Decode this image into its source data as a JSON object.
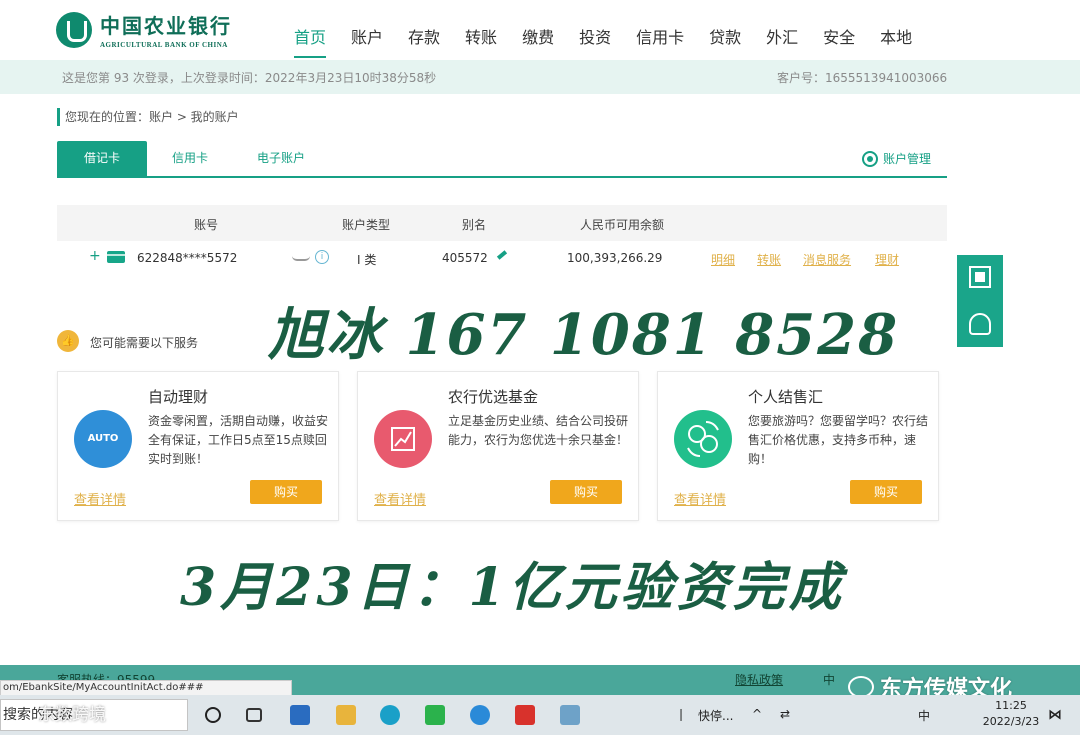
{
  "header": {
    "logo_cn": "中国农业银行",
    "logo_en": "AGRICULTURAL BANK OF CHINA",
    "nav": [
      "首页",
      "账户",
      "存款",
      "转账",
      "缴费",
      "投资",
      "信用卡",
      "贷款",
      "外汇",
      "安全",
      "本地"
    ],
    "active_nav": "首页"
  },
  "login_bar": {
    "login_info": "这是您第 93 次登录，上次登录时间：2022年3月23日10时38分58秒",
    "customer_no": "客户号：1655513941003066"
  },
  "breadcrumb": "您现在的位置：账户 > 我的账户",
  "tabs": {
    "items": [
      "借记卡",
      "信用卡",
      "电子账户"
    ],
    "active": "借记卡",
    "account_mgmt": "账户管理"
  },
  "account_table": {
    "headers": [
      "账号",
      "账户类型",
      "别名",
      "人民币可用余额"
    ],
    "row": {
      "plus": "+",
      "account": "622848****5572",
      "type": "I 类",
      "alias": "405572",
      "balance": "100,393,266.29",
      "actions": [
        "明细",
        "转账",
        "消息服务",
        "理财"
      ]
    }
  },
  "services": {
    "title": "您可能需要以下服务",
    "cards": [
      {
        "title": "自动理财",
        "desc": "资金零闲置，活期自动赚，收益安全有保证，工作日5点至15点赎回实时到账！",
        "icon_label": "AUTO",
        "icon_color": "#2f8fd8",
        "detail": "查看详情",
        "buy": "购买"
      },
      {
        "title": "农行优选基金",
        "desc": "立足基金历史业绩、结合公司投研能力，农行为您优选十余只基金！",
        "icon_label": "",
        "icon_color": "#e85a6e",
        "detail": "查看详情",
        "buy": "购买"
      },
      {
        "title": "个人结售汇",
        "desc": "您要旅游吗？您要留学吗？农行结售汇价格优惠，支持多币种，速购！",
        "icon_label": "",
        "icon_color": "#22bf8c",
        "detail": "查看详情",
        "buy": "购买"
      }
    ]
  },
  "overlay": {
    "line1": "旭冰 167 1081 8528",
    "line2": "3月23日：1亿元验资完成"
  },
  "footer": {
    "hotline": "客服热线：95599",
    "privacy": "隐私政策",
    "cut_text": "中",
    "url_tip": "om/EbankSite/MyAccountInitAct.do###",
    "watermark": "东方传媒文化"
  },
  "taskbar": {
    "search_text": "搜索的内容",
    "watermark2": "东数跨境",
    "app_label": "快停...",
    "tray_lang": "中",
    "time": "11:25",
    "date": "2022/3/23"
  },
  "colors": {
    "brand": "#16a085",
    "accent": "#f0a71c",
    "overlay_text": "#1a5e43"
  }
}
